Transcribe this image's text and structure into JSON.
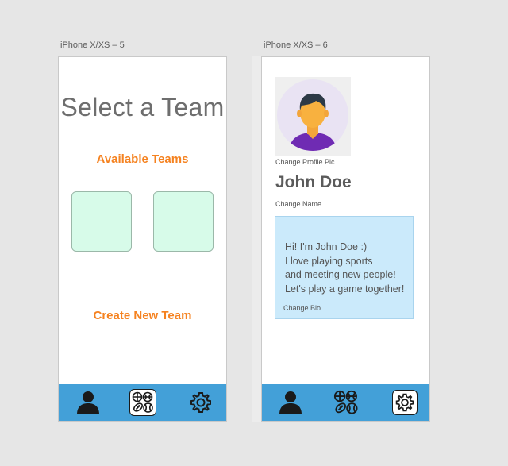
{
  "canvas": {
    "artboard1_label": "iPhone X/XS – 5",
    "artboard2_label": "iPhone X/XS – 6"
  },
  "select_team_screen": {
    "title": "Select a Team",
    "available_teams_label": "Available Teams",
    "create_team_label": "Create New Team",
    "team_slots": [
      {
        "color": "#d7fbe9"
      },
      {
        "color": "#d7fbe9"
      }
    ],
    "active_tab": "teams"
  },
  "profile_screen": {
    "change_pic_label": "Change Profile Pic",
    "name": "John Doe",
    "change_name_label": "Change Name",
    "bio_lines": [
      "Hi! I'm John Doe :)",
      "I love playing sports",
      "and meeting new people!",
      "Let's play a game together!"
    ],
    "change_bio_label": "Change Bio",
    "active_tab": "settings"
  },
  "tabbar": {
    "color": "#43a0d8",
    "items": [
      {
        "name": "profile",
        "icon": "person-icon"
      },
      {
        "name": "teams",
        "icon": "sports-balls-icon"
      },
      {
        "name": "settings",
        "icon": "gear-icon"
      }
    ]
  },
  "colors": {
    "accent_orange": "#f58220",
    "team_box": "#d7fbe9",
    "bio_box": "#cbeafb"
  }
}
